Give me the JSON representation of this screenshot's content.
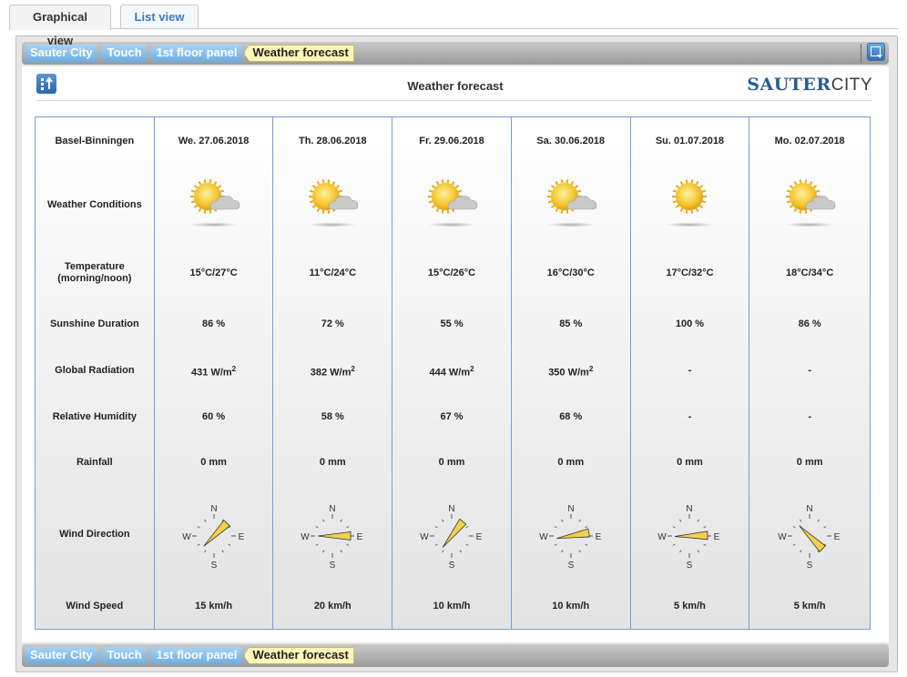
{
  "tabs": [
    {
      "label": "Graphical view",
      "active": true
    },
    {
      "label": "List view",
      "active": false
    }
  ],
  "breadcrumb": [
    "Sauter City",
    "Touch",
    "1st floor panel",
    "Weather forecast"
  ],
  "panel": {
    "title": "Weather forecast",
    "brand_bold": "SAUTER",
    "brand_light": "CITY"
  },
  "row_labels": {
    "location": "Basel-Binningen",
    "conditions": "Weather Conditions",
    "temperature_1": "Temperature",
    "temperature_2": "(morning/noon)",
    "sunshine": "Sunshine Duration",
    "radiation": "Global Radiation",
    "humidity": "Relative Humidity",
    "rainfall": "Rainfall",
    "wind_direction": "Wind Direction",
    "wind_speed": "Wind Speed"
  },
  "compass_labels": {
    "n": "N",
    "e": "E",
    "s": "S",
    "w": "W"
  },
  "radiation_unit_sup": "2",
  "days": [
    {
      "date": "We. 27.06.2018",
      "icon": "sun-cloud-icon",
      "temperature": "15°C/27°C",
      "sunshine": "86 %",
      "radiation": "431 W/m",
      "radiation_shown": true,
      "humidity": "60 %",
      "rainfall": "0 mm",
      "wind_bearing_deg": 45,
      "wind_speed": "15 km/h"
    },
    {
      "date": "Th. 28.06.2018",
      "icon": "sun-cloud-icon",
      "temperature": "11°C/24°C",
      "sunshine": "72 %",
      "radiation": "382 W/m",
      "radiation_shown": true,
      "humidity": "58 %",
      "rainfall": "0 mm",
      "wind_bearing_deg": 90,
      "wind_speed": "20 km/h"
    },
    {
      "date": "Fr. 29.06.2018",
      "icon": "sun-cloud-icon",
      "temperature": "15°C/26°C",
      "sunshine": "55 %",
      "radiation": "444 W/m",
      "radiation_shown": true,
      "humidity": "67 %",
      "rainfall": "0 mm",
      "wind_bearing_deg": 38,
      "wind_speed": "10 km/h"
    },
    {
      "date": "Sa. 30.06.2018",
      "icon": "sun-cloud-icon",
      "temperature": "16°C/30°C",
      "sunshine": "85 %",
      "radiation": "350 W/m",
      "radiation_shown": true,
      "humidity": "68 %",
      "rainfall": "0 mm",
      "wind_bearing_deg": 80,
      "wind_speed": "10 km/h"
    },
    {
      "date": "Su. 01.07.2018",
      "icon": "sun-icon",
      "temperature": "17°C/32°C",
      "sunshine": "100 %",
      "radiation": "-",
      "radiation_shown": false,
      "humidity": "-",
      "rainfall": "0 mm",
      "wind_bearing_deg": 88,
      "wind_speed": "5 km/h"
    },
    {
      "date": "Mo. 02.07.2018",
      "icon": "sun-cloud-icon",
      "temperature": "18°C/34°C",
      "sunshine": "86 %",
      "radiation": "-",
      "radiation_shown": false,
      "humidity": "-",
      "rainfall": "0 mm",
      "wind_bearing_deg": 135,
      "wind_speed": "5 km/h"
    }
  ],
  "colors": {
    "accent": "#2a66ad",
    "grid_border": "#6fa1d3",
    "crumb_current": "#fff6b8",
    "wind_arrow": "#f2d24a"
  }
}
